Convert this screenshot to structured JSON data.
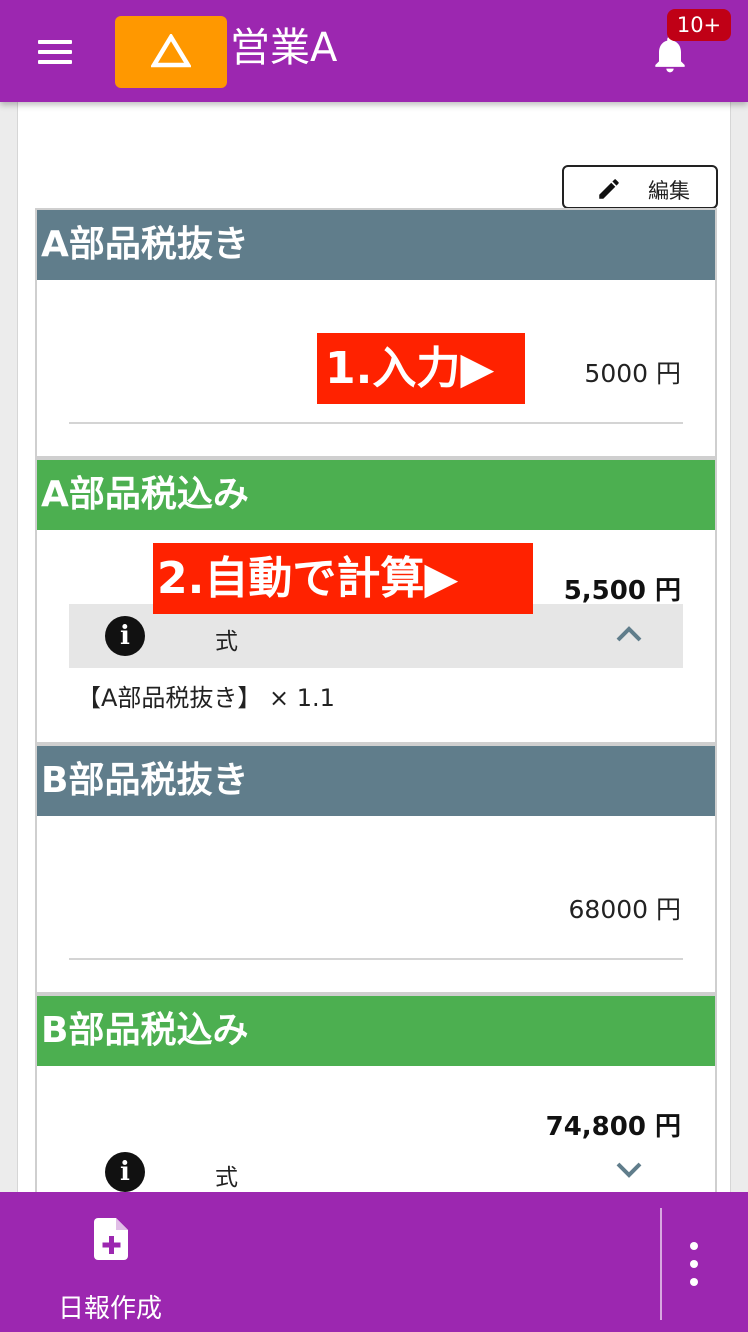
{
  "header": {
    "app_title": "営業A",
    "menu_icon": "hamburger-menu-icon",
    "logo_icon": "triangle-logo-icon",
    "notification_badge": "10+",
    "bell_icon": "bell-icon",
    "color_bar": "#9c27b0",
    "color_logo": "#ff9800"
  },
  "toolbar": {
    "edit_label": "編集",
    "edit_icon": "pencil-icon"
  },
  "sections": [
    {
      "title": "A部品税抜き",
      "value": "5000 円",
      "type": "input",
      "header_color": "#607d8b"
    },
    {
      "title": "A部品税込み",
      "value": "5,500 円",
      "type": "calculated",
      "header_color": "#4caf50",
      "formula_label": "式",
      "formula_text": "【A部品税抜き】 × 1.1",
      "formula_expanded": true
    },
    {
      "title": "B部品税抜き",
      "value": "68000 円",
      "type": "input",
      "header_color": "#607d8b"
    },
    {
      "title": "B部品税込み",
      "value": "74,800 円",
      "type": "calculated",
      "header_color": "#4caf50",
      "formula_label": "式",
      "formula_expanded": false
    }
  ],
  "callouts": {
    "input": "1.入力▶",
    "auto_calc": "2.自動で計算▶"
  },
  "bottom_bar": {
    "create_label": "日報作成",
    "create_icon": "add-document-icon",
    "more_icon": "more-vertical-icon"
  }
}
